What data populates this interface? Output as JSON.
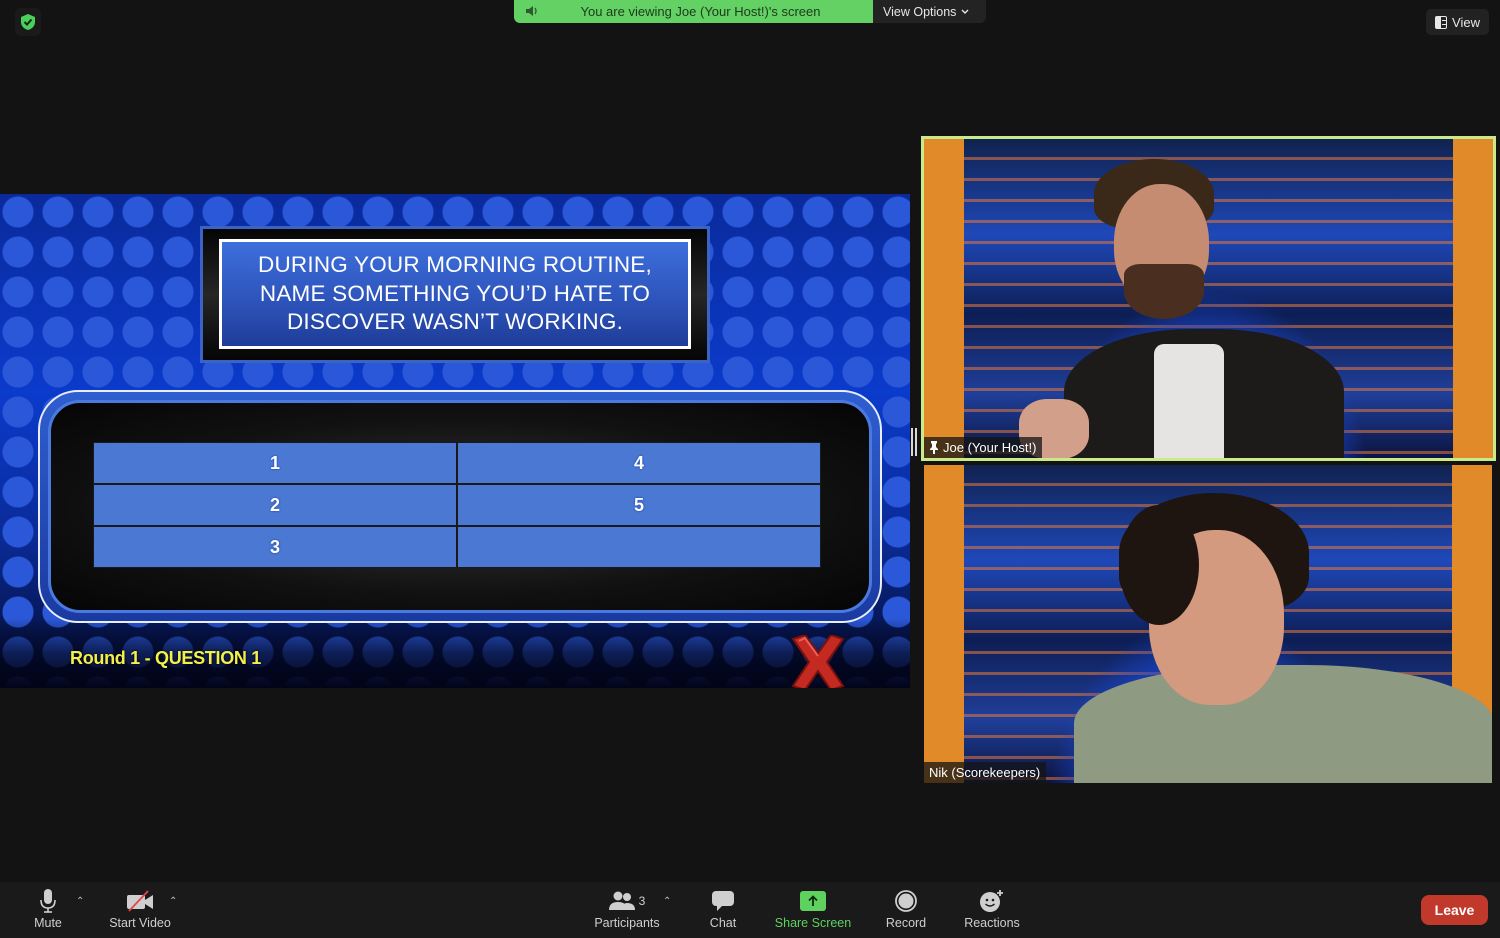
{
  "top": {
    "security_icon": "shield-check-icon",
    "banner_text": "You are viewing Joe (Your Host!)'s screen",
    "view_options_label": "View Options",
    "view_label": "View"
  },
  "shared_screen": {
    "question": "DURING YOUR MORNING ROUTINE, NAME SOMETHING YOU’D HATE TO DISCOVER WASN’T WORKING.",
    "answers": [
      "1",
      "4",
      "2",
      "5",
      "3",
      ""
    ],
    "round_label": "Round 1 - QUESTION 1",
    "strike_icon": "red-x-icon"
  },
  "participants_videos": [
    {
      "name": "Joe (Your Host!)",
      "pinned": true,
      "active_speaker": true
    },
    {
      "name": "Nik (Scorekeepers)",
      "pinned": false,
      "active_speaker": false
    }
  ],
  "toolbar": {
    "mute_label": "Mute",
    "start_video_label": "Start Video",
    "participants_label": "Participants",
    "participants_count": "3",
    "chat_label": "Chat",
    "share_screen_label": "Share Screen",
    "record_label": "Record",
    "reactions_label": "Reactions",
    "leave_label": "Leave"
  },
  "colors": {
    "banner_green": "#63d163",
    "share_green": "#5fd15f",
    "active_speaker_border": "#c8ea8a",
    "leave_red": "#c0392b",
    "round_label_yellow": "#f3f04a",
    "answer_cell_blue": "#4a78d3"
  }
}
